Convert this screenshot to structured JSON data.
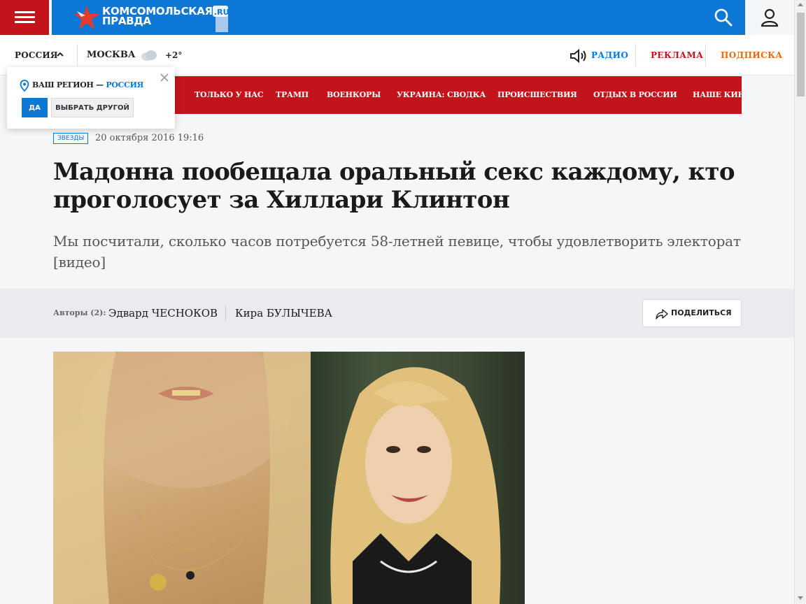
{
  "site": {
    "logo_line1": "КОМСОМОЛЬСКАЯ",
    "logo_line2": "ПРАВДА",
    "logo_suffix": ".RU",
    "brand_color": "#0d77d6",
    "accent_color": "#c3141b"
  },
  "topbar": {
    "region": "РОССИЯ",
    "city": "МОСКВА",
    "temperature": "+2°",
    "radio": "РАДИО",
    "ads": "РЕКЛАМА",
    "subscribe": "ПОДПИСКА"
  },
  "nav": {
    "items": [
      "ТОЛЬКО У НАС",
      "ТРАМП",
      "ВОЕНКОРЫ",
      "УКРАИНА: СВОДКА",
      "ПРОИСШЕСТВИЯ",
      "ОТДЫХ В РОССИИ",
      "НАШЕ КИНО"
    ]
  },
  "region_popup": {
    "question": "ВАШ РЕГИОН — ",
    "region": "РОССИЯ",
    "yes": "ДА",
    "other": "ВЫБРАТЬ ДРУГОЙ"
  },
  "article": {
    "tag": "ЗВЕЗДЫ",
    "date": "20 октября 2016 19:16",
    "title": "Мадонна пообещала оральный секс каждому, кто проголосует за Хиллари Клинтон",
    "lede": "Мы посчитали, сколько часов потребуется 58-летней певице, чтобы удовлетворить электорат [видео]",
    "authors_label": "Авторы (2):",
    "authors": [
      "Эдвард ЧЕСНОКОВ",
      "Кира БУЛЫЧЕВА"
    ],
    "share": "ПОДЕЛИТЬСЯ"
  }
}
